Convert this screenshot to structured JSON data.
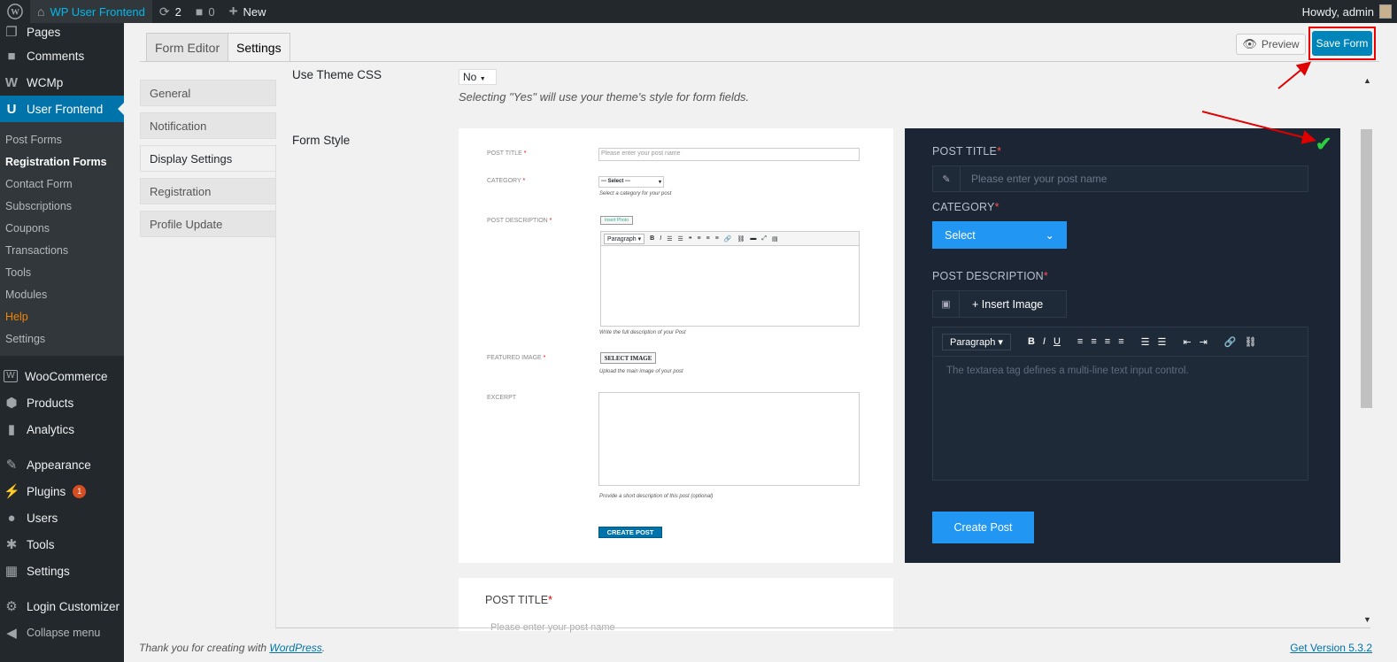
{
  "adminbar": {
    "site_name": "WP User Frontend",
    "updates_count": "2",
    "comments_count": "0",
    "new_label": "New",
    "howdy": "Howdy, admin"
  },
  "menu": {
    "pages": "Pages",
    "comments": "Comments",
    "wcmp": "WCMp",
    "user_frontend": "User Frontend",
    "submenu": [
      "Post Forms",
      "Registration Forms",
      "Contact Form",
      "Subscriptions",
      "Coupons",
      "Transactions",
      "Tools",
      "Modules",
      "Help",
      "Settings"
    ],
    "woocommerce": "WooCommerce",
    "products": "Products",
    "analytics": "Analytics",
    "appearance": "Appearance",
    "plugins": "Plugins",
    "plugins_badge": "1",
    "users": "Users",
    "tools": "Tools",
    "settings": "Settings",
    "login_customizer": "Login Customizer",
    "collapse": "Collapse menu"
  },
  "tabs": {
    "form_editor": "Form Editor",
    "settings": "Settings"
  },
  "actions": {
    "preview": "Preview",
    "save": "Save Form"
  },
  "settings_tabs": [
    "General",
    "Notification",
    "Display Settings",
    "Registration",
    "Profile Update"
  ],
  "display": {
    "theme_css_label": "Use Theme CSS",
    "theme_css_value": "No",
    "theme_css_hint": "Selecting \"Yes\" will use your theme's style for form fields.",
    "form_style_label": "Form Style"
  },
  "preview_light": {
    "post_title": "POST TITLE",
    "post_title_ph": "Please enter your post name",
    "category": "CATEGORY",
    "category_select": "--- Select ---",
    "category_help": "Select a category for your post",
    "post_description": "POST DESCRIPTION",
    "insert_photo": "Insert Photo",
    "paragraph": "Paragraph",
    "desc_help": "Write the full description of your Post",
    "featured_image": "FEATURED IMAGE",
    "select_image": "SELECT IMAGE",
    "featured_help": "Upload the main image of your post",
    "excerpt": "EXCERPT",
    "excerpt_help": "Provide a short description of this post (optional)",
    "create_post": "CREATE POST"
  },
  "preview_dark": {
    "post_title": "POST TITLE",
    "post_title_ph": "Please enter your post name",
    "category": "CATEGORY",
    "select": "Select",
    "post_description": "POST DESCRIPTION",
    "insert_image": "+ Insert Image",
    "paragraph": "Paragraph",
    "textarea_ph": "The textarea tag defines a multi-line text input control.",
    "create_post": "Create Post"
  },
  "preview_bottom": {
    "post_title": "POST TITLE",
    "post_title_ph": "Please enter your post name"
  },
  "footer": {
    "thanks_prefix": "Thank you for creating with ",
    "wordpress": "WordPress",
    "thanks_suffix": ".",
    "version": "Get Version 5.3.2"
  },
  "colors": {
    "accent": "#0073aa",
    "save": "#0085ba",
    "dark_bg": "#1b2533",
    "blue_btn": "#2196f3",
    "annotation": "#e00000",
    "check": "#2ecc40"
  }
}
